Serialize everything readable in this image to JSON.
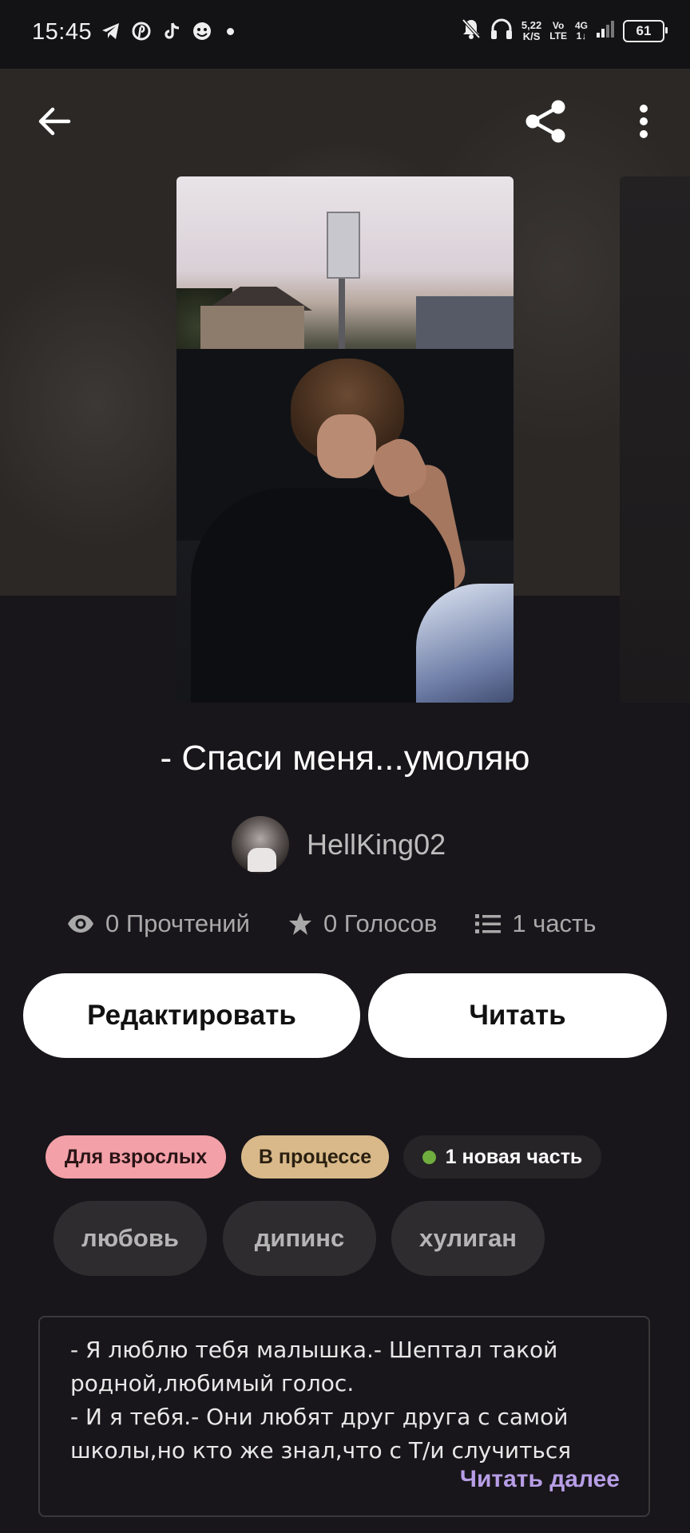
{
  "status_bar": {
    "time": "15:45",
    "app_icons": [
      "telegram-icon",
      "pinterest-icon",
      "tiktok-icon",
      "emoji-app-icon"
    ],
    "speed_value": "5,22",
    "speed_unit": "K/S",
    "volte_top": "Vo",
    "volte_bottom": "LTE",
    "network_top": "4G",
    "network_bottom": "1↓",
    "battery": "61"
  },
  "toolbar": {
    "back_icon": "arrow-left-icon",
    "share_icon": "share-icon",
    "more_icon": "more-vertical-icon"
  },
  "story": {
    "title": "- Спаси меня...умоляю",
    "author": "HellKing02",
    "stats": {
      "reads": "0 Прочтений",
      "votes": "0 Голосов",
      "parts": "1 часть"
    }
  },
  "actions": {
    "edit_label": "Редактировать",
    "read_label": "Читать"
  },
  "badges": {
    "adult": "Для взрослых",
    "status": "В процессе",
    "new_part": "1 новая часть"
  },
  "badge_colors": {
    "adult": "#f3a0a8",
    "status": "#d9b98a",
    "new_dot": "#6fae3e"
  },
  "tags": [
    "любовь",
    "дипинс",
    "хулиган"
  ],
  "description": {
    "lines": [
      "- Я люблю тебя малышка.- Шептал такой",
      "родной,любимый голос.",
      "- И я тебя.- Они любят друг друга с самой",
      "школы,но кто же знал,что с Т/и случиться"
    ],
    "read_more": "Читать далее"
  },
  "accent_color": "#b79ee6"
}
